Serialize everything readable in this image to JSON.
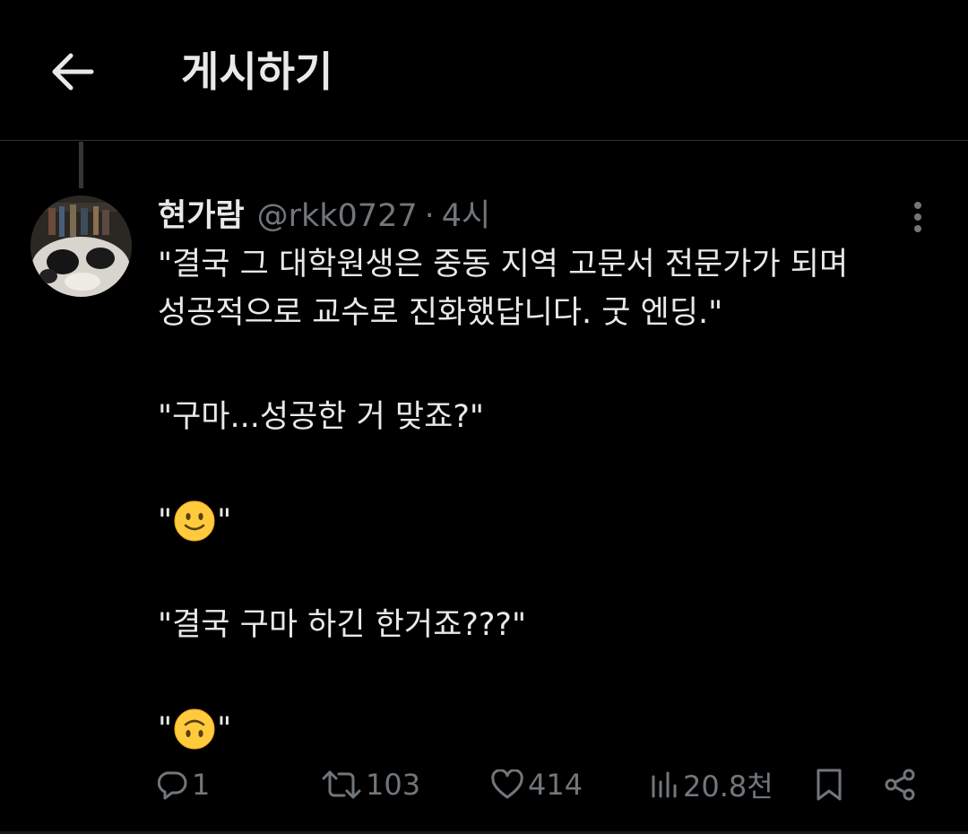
{
  "header": {
    "back_icon": "arrow-left-icon",
    "title": "게시하기"
  },
  "tweet": {
    "display_name": "현가람",
    "handle": "@rkk0727",
    "separator": "·",
    "time": "4시",
    "lines": {
      "l1": "\"결국 그 대학원생은 중동 지역 고문서 전문가가 되며",
      "l2": "성공적으로 교수로 진화했답니다. 굿 엔딩.\"",
      "l3": "\"구마...성공한 거 맞죠?\"",
      "l4_quote_open": "\"",
      "l4_quote_close": "\"",
      "l5": "\"결국 구마 하긴 한거죠???\"",
      "l6_quote_open": "\"",
      "l6_quote_close": "\""
    },
    "emojis": [
      "slightly-smiling-face",
      "upside-down-face"
    ]
  },
  "actions": {
    "reply": {
      "icon": "reply-icon",
      "count": "1"
    },
    "retweet": {
      "icon": "retweet-icon",
      "count": "103"
    },
    "like": {
      "icon": "heart-icon",
      "count": "414"
    },
    "views": {
      "icon": "views-chart-icon",
      "count": "20.8천"
    },
    "bookmark": {
      "icon": "bookmark-icon"
    },
    "share": {
      "icon": "share-icon"
    }
  },
  "colors": {
    "background": "#000000",
    "text_primary": "#e7e9ea",
    "text_secondary": "#71767b",
    "divider": "#2f3336"
  }
}
